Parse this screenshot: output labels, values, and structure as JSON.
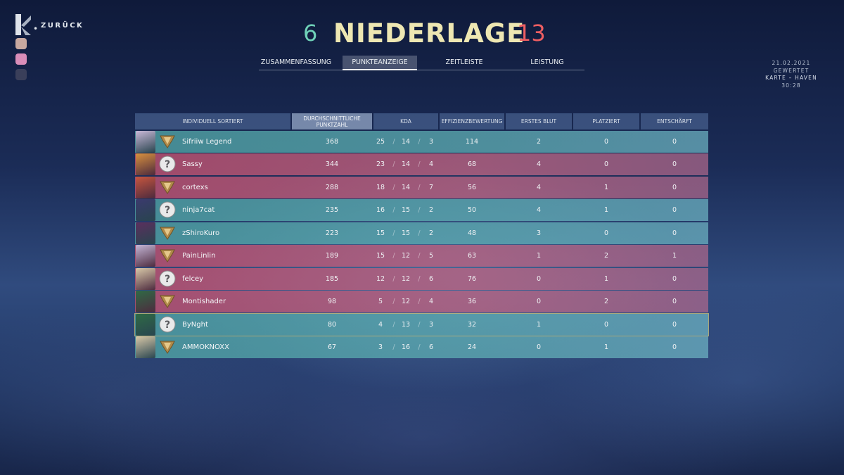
{
  "back": {
    "label": "ZURÜCK"
  },
  "party": [
    {
      "icon": "player-card-icon",
      "color": "#c8a9a0"
    },
    {
      "icon": "player-card-icon",
      "color": "#d98db8"
    },
    {
      "icon": "player-card-icon",
      "color": "#3a3f5a"
    }
  ],
  "title": {
    "score_left": "6",
    "result": "NIEDERLAGE",
    "score_right": "13"
  },
  "tabs": [
    {
      "label": "ZUSAMMENFASSUNG"
    },
    {
      "label": "PUNKTEANZEIGE"
    },
    {
      "label": "ZEITLEISTE"
    },
    {
      "label": "LEISTUNG"
    }
  ],
  "match": {
    "date": "21.02.2021",
    "mode": "GEWERTET",
    "map": "KARTE – HAVEN",
    "duration": "30:28"
  },
  "columns": {
    "player": "INDIVIDUELL SORTIERT",
    "acs": "DURCHSCHNITTLICHE PUNKTZAHL",
    "kda": "KDA",
    "econ": "EFFIZIENZBEWERTUNG",
    "first_blood": "ERSTES BLUT",
    "plants": "PLATZIERT",
    "defuses": "ENTSCHÄRFT"
  },
  "rows": [
    {
      "team": "win",
      "agent_color": "#c9b8d8",
      "rank": "ranked-icon",
      "name": "Sifriiw Legend",
      "acs": "368",
      "k": "25",
      "d": "14",
      "a": "3",
      "econ": "114",
      "fb": "2",
      "plants": "0",
      "defuses": "0"
    },
    {
      "team": "loss",
      "agent_color": "#d8913f",
      "rank": "unranked-icon",
      "name": "Sassy",
      "acs": "344",
      "k": "23",
      "d": "14",
      "a": "4",
      "econ": "68",
      "fb": "4",
      "plants": "0",
      "defuses": "0"
    },
    {
      "team": "loss",
      "agent_color": "#c7563f",
      "rank": "ranked-icon",
      "name": "cortexs",
      "acs": "288",
      "k": "18",
      "d": "14",
      "a": "7",
      "econ": "56",
      "fb": "4",
      "plants": "1",
      "defuses": "0"
    },
    {
      "team": "win",
      "agent_color": "#3b3a6e",
      "rank": "unranked-icon",
      "name": "ninja7cat",
      "acs": "235",
      "k": "16",
      "d": "15",
      "a": "2",
      "econ": "50",
      "fb": "4",
      "plants": "1",
      "defuses": "0"
    },
    {
      "team": "win",
      "agent_color": "#5b2f5e",
      "rank": "ranked-icon",
      "name": "zShiroKuro",
      "acs": "223",
      "k": "15",
      "d": "15",
      "a": "2",
      "econ": "48",
      "fb": "3",
      "plants": "0",
      "defuses": "0"
    },
    {
      "team": "loss",
      "agent_color": "#c4b6d6",
      "rank": "ranked-icon",
      "name": "PainLinlin",
      "acs": "189",
      "k": "15",
      "d": "12",
      "a": "5",
      "econ": "63",
      "fb": "1",
      "plants": "2",
      "defuses": "1"
    },
    {
      "team": "loss",
      "agent_color": "#d8c8a8",
      "rank": "unranked-icon",
      "name": "felcey",
      "acs": "185",
      "k": "12",
      "d": "12",
      "a": "6",
      "econ": "76",
      "fb": "0",
      "plants": "1",
      "defuses": "0"
    },
    {
      "team": "loss",
      "agent_color": "#2f6a45",
      "rank": "ranked-icon",
      "name": "Montishader",
      "acs": "98",
      "k": "5",
      "d": "12",
      "a": "4",
      "econ": "36",
      "fb": "0",
      "plants": "2",
      "defuses": "0"
    },
    {
      "team": "win",
      "agent_color": "#2f6a45",
      "rank": "unranked-icon",
      "name": "ByNght",
      "acs": "80",
      "k": "4",
      "d": "13",
      "a": "3",
      "econ": "32",
      "fb": "1",
      "plants": "0",
      "defuses": "0"
    },
    {
      "team": "win",
      "agent_color": "#d8c8a8",
      "rank": "ranked-icon",
      "name": "AMMOKNOXX",
      "acs": "67",
      "k": "3",
      "d": "16",
      "a": "6",
      "econ": "24",
      "fb": "0",
      "plants": "1",
      "defuses": "0"
    }
  ]
}
